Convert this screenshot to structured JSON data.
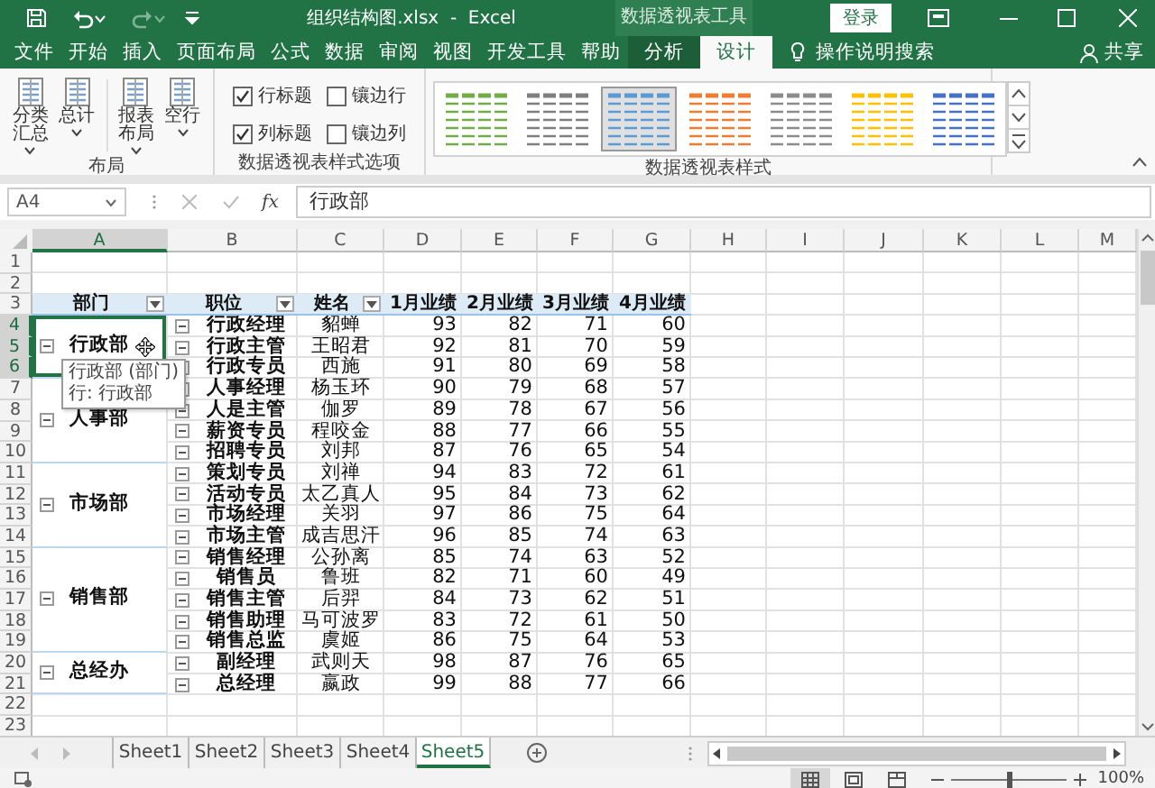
{
  "window": {
    "title": "组织结构图.xlsx  -  Excel",
    "context_title": "数据透视表工具",
    "login_button": "登录"
  },
  "menu_tabs": [
    {
      "label": "文件",
      "selected": false,
      "context": false
    },
    {
      "label": "开始",
      "selected": false,
      "context": false
    },
    {
      "label": "插入",
      "selected": false,
      "context": false
    },
    {
      "label": "页面布局",
      "selected": false,
      "context": false
    },
    {
      "label": "公式",
      "selected": false,
      "context": false
    },
    {
      "label": "数据",
      "selected": false,
      "context": false
    },
    {
      "label": "审阅",
      "selected": false,
      "context": false
    },
    {
      "label": "视图",
      "selected": false,
      "context": false
    },
    {
      "label": "开发工具",
      "selected": false,
      "context": false
    },
    {
      "label": "帮助",
      "selected": false,
      "context": false
    },
    {
      "label": "分析",
      "selected": false,
      "context": true
    },
    {
      "label": "设计",
      "selected": true,
      "context": true
    }
  ],
  "tell_me": "操作说明搜索",
  "share": "共享",
  "ribbon": {
    "groups": [
      {
        "kind": "buttons",
        "label": "布局",
        "buttons": [
          {
            "label": "分类汇总"
          },
          {
            "label": "总计"
          },
          {
            "label": "报表布局"
          },
          {
            "label": "空行"
          }
        ]
      },
      {
        "kind": "checks",
        "label": "数据透视表样式选项",
        "options": [
          {
            "label": "行标题",
            "checked": true
          },
          {
            "label": "镶边行",
            "checked": false
          },
          {
            "label": "列标题",
            "checked": true
          },
          {
            "label": "镶边列",
            "checked": false
          }
        ]
      },
      {
        "kind": "gallery",
        "label": "数据透视表样式",
        "styles": [
          {
            "color": "#70ad47",
            "selected": false
          },
          {
            "color": "#7f7f7f",
            "selected": false
          },
          {
            "color": "#5b9bd5",
            "selected": true
          },
          {
            "color": "#ed7d31",
            "selected": false
          },
          {
            "color": "#8c8c8c",
            "selected": false
          },
          {
            "color": "#ffc000",
            "selected": false
          },
          {
            "color": "#4472c4",
            "selected": false
          }
        ]
      }
    ]
  },
  "formula_bar": {
    "name_box": "A4",
    "function_symbol": "fx",
    "value": "行政部"
  },
  "sheet": {
    "columns": [
      {
        "label": "A",
        "selected": true
      },
      {
        "label": "B",
        "selected": false
      },
      {
        "label": "C",
        "selected": false
      },
      {
        "label": "D",
        "selected": false
      },
      {
        "label": "E",
        "selected": false
      },
      {
        "label": "F",
        "selected": false
      },
      {
        "label": "G",
        "selected": false
      },
      {
        "label": "H",
        "selected": false
      },
      {
        "label": "I",
        "selected": false
      },
      {
        "label": "J",
        "selected": false
      },
      {
        "label": "K",
        "selected": false
      },
      {
        "label": "L",
        "selected": false
      },
      {
        "label": "M",
        "selected": false
      }
    ],
    "rows": [
      {
        "label": "1",
        "selected": false
      },
      {
        "label": "2",
        "selected": false
      },
      {
        "label": "3",
        "selected": false
      },
      {
        "label": "4",
        "selected": true
      },
      {
        "label": "5",
        "selected": true
      },
      {
        "label": "6",
        "selected": true
      },
      {
        "label": "7",
        "selected": false
      },
      {
        "label": "8",
        "selected": false
      },
      {
        "label": "9",
        "selected": false
      },
      {
        "label": "10",
        "selected": false
      },
      {
        "label": "11",
        "selected": false
      },
      {
        "label": "12",
        "selected": false
      },
      {
        "label": "13",
        "selected": false
      },
      {
        "label": "14",
        "selected": false
      },
      {
        "label": "15",
        "selected": false
      },
      {
        "label": "16",
        "selected": false
      },
      {
        "label": "17",
        "selected": false
      },
      {
        "label": "18",
        "selected": false
      },
      {
        "label": "19",
        "selected": false
      },
      {
        "label": "20",
        "selected": false
      },
      {
        "label": "21",
        "selected": false
      },
      {
        "label": "22",
        "selected": false
      },
      {
        "label": "23",
        "selected": false
      }
    ],
    "pivot": {
      "headers": [
        {
          "label": "部门",
          "filter": true
        },
        {
          "label": "职位",
          "filter": true
        },
        {
          "label": "姓名",
          "filter": true
        },
        {
          "label": "1月业绩",
          "filter": false
        },
        {
          "label": "2月业绩",
          "filter": false
        },
        {
          "label": "3月业绩",
          "filter": false
        },
        {
          "label": "4月业绩",
          "filter": false
        }
      ],
      "groups": [
        {
          "label": "行政部",
          "selected": true,
          "items": [
            {
              "position": "行政经理",
              "name": "貂蝉",
              "values": [
                "93",
                "82",
                "71",
                "60"
              ]
            },
            {
              "position": "行政主管",
              "name": "王昭君",
              "values": [
                "92",
                "81",
                "70",
                "59"
              ]
            },
            {
              "position": "行政专员",
              "name": "西施",
              "values": [
                "91",
                "80",
                "69",
                "58"
              ]
            }
          ]
        },
        {
          "label": "人事部",
          "selected": false,
          "items": [
            {
              "position": "人事经理",
              "name": "杨玉环",
              "values": [
                "90",
                "79",
                "68",
                "57"
              ]
            },
            {
              "position": "人是主管",
              "name": "伽罗",
              "values": [
                "89",
                "78",
                "67",
                "56"
              ]
            },
            {
              "position": "薪资专员",
              "name": "程咬金",
              "values": [
                "88",
                "77",
                "66",
                "55"
              ]
            },
            {
              "position": "招聘专员",
              "name": "刘邦",
              "values": [
                "87",
                "76",
                "65",
                "54"
              ]
            }
          ]
        },
        {
          "label": "市场部",
          "selected": false,
          "items": [
            {
              "position": "策划专员",
              "name": "刘禅",
              "values": [
                "94",
                "83",
                "72",
                "61"
              ]
            },
            {
              "position": "活动专员",
              "name": "太乙真人",
              "values": [
                "95",
                "84",
                "73",
                "62"
              ]
            },
            {
              "position": "市场经理",
              "name": "关羽",
              "values": [
                "97",
                "86",
                "75",
                "64"
              ]
            },
            {
              "position": "市场主管",
              "name": "成吉思汗",
              "values": [
                "96",
                "85",
                "74",
                "63"
              ]
            }
          ]
        },
        {
          "label": "销售部",
          "selected": false,
          "items": [
            {
              "position": "销售经理",
              "name": "公孙离",
              "values": [
                "85",
                "74",
                "63",
                "52"
              ]
            },
            {
              "position": "销售员",
              "name": "鲁班",
              "values": [
                "82",
                "71",
                "60",
                "49"
              ]
            },
            {
              "position": "销售主管",
              "name": "后羿",
              "values": [
                "84",
                "73",
                "62",
                "51"
              ]
            },
            {
              "position": "销售助理",
              "name": "马可波罗",
              "values": [
                "83",
                "72",
                "61",
                "50"
              ]
            },
            {
              "position": "销售总监",
              "name": "虞姬",
              "values": [
                "86",
                "75",
                "64",
                "53"
              ]
            }
          ]
        },
        {
          "label": "总经办",
          "selected": false,
          "items": [
            {
              "position": "副经理",
              "name": "武则天",
              "values": [
                "98",
                "87",
                "76",
                "65"
              ]
            },
            {
              "position": "总经理",
              "name": "嬴政",
              "values": [
                "99",
                "88",
                "77",
                "66"
              ]
            }
          ]
        }
      ]
    },
    "tooltip": [
      "行政部 (部门)",
      "行: 行政部"
    ]
  },
  "sheet_tabs": [
    {
      "label": "Sheet1",
      "selected": false
    },
    {
      "label": "Sheet2",
      "selected": false
    },
    {
      "label": "Sheet3",
      "selected": false
    },
    {
      "label": "Sheet4",
      "selected": false
    },
    {
      "label": "Sheet5",
      "selected": true
    }
  ],
  "status_bar": {
    "zoom": {
      "level": 0.5,
      "label": "100%"
    }
  }
}
